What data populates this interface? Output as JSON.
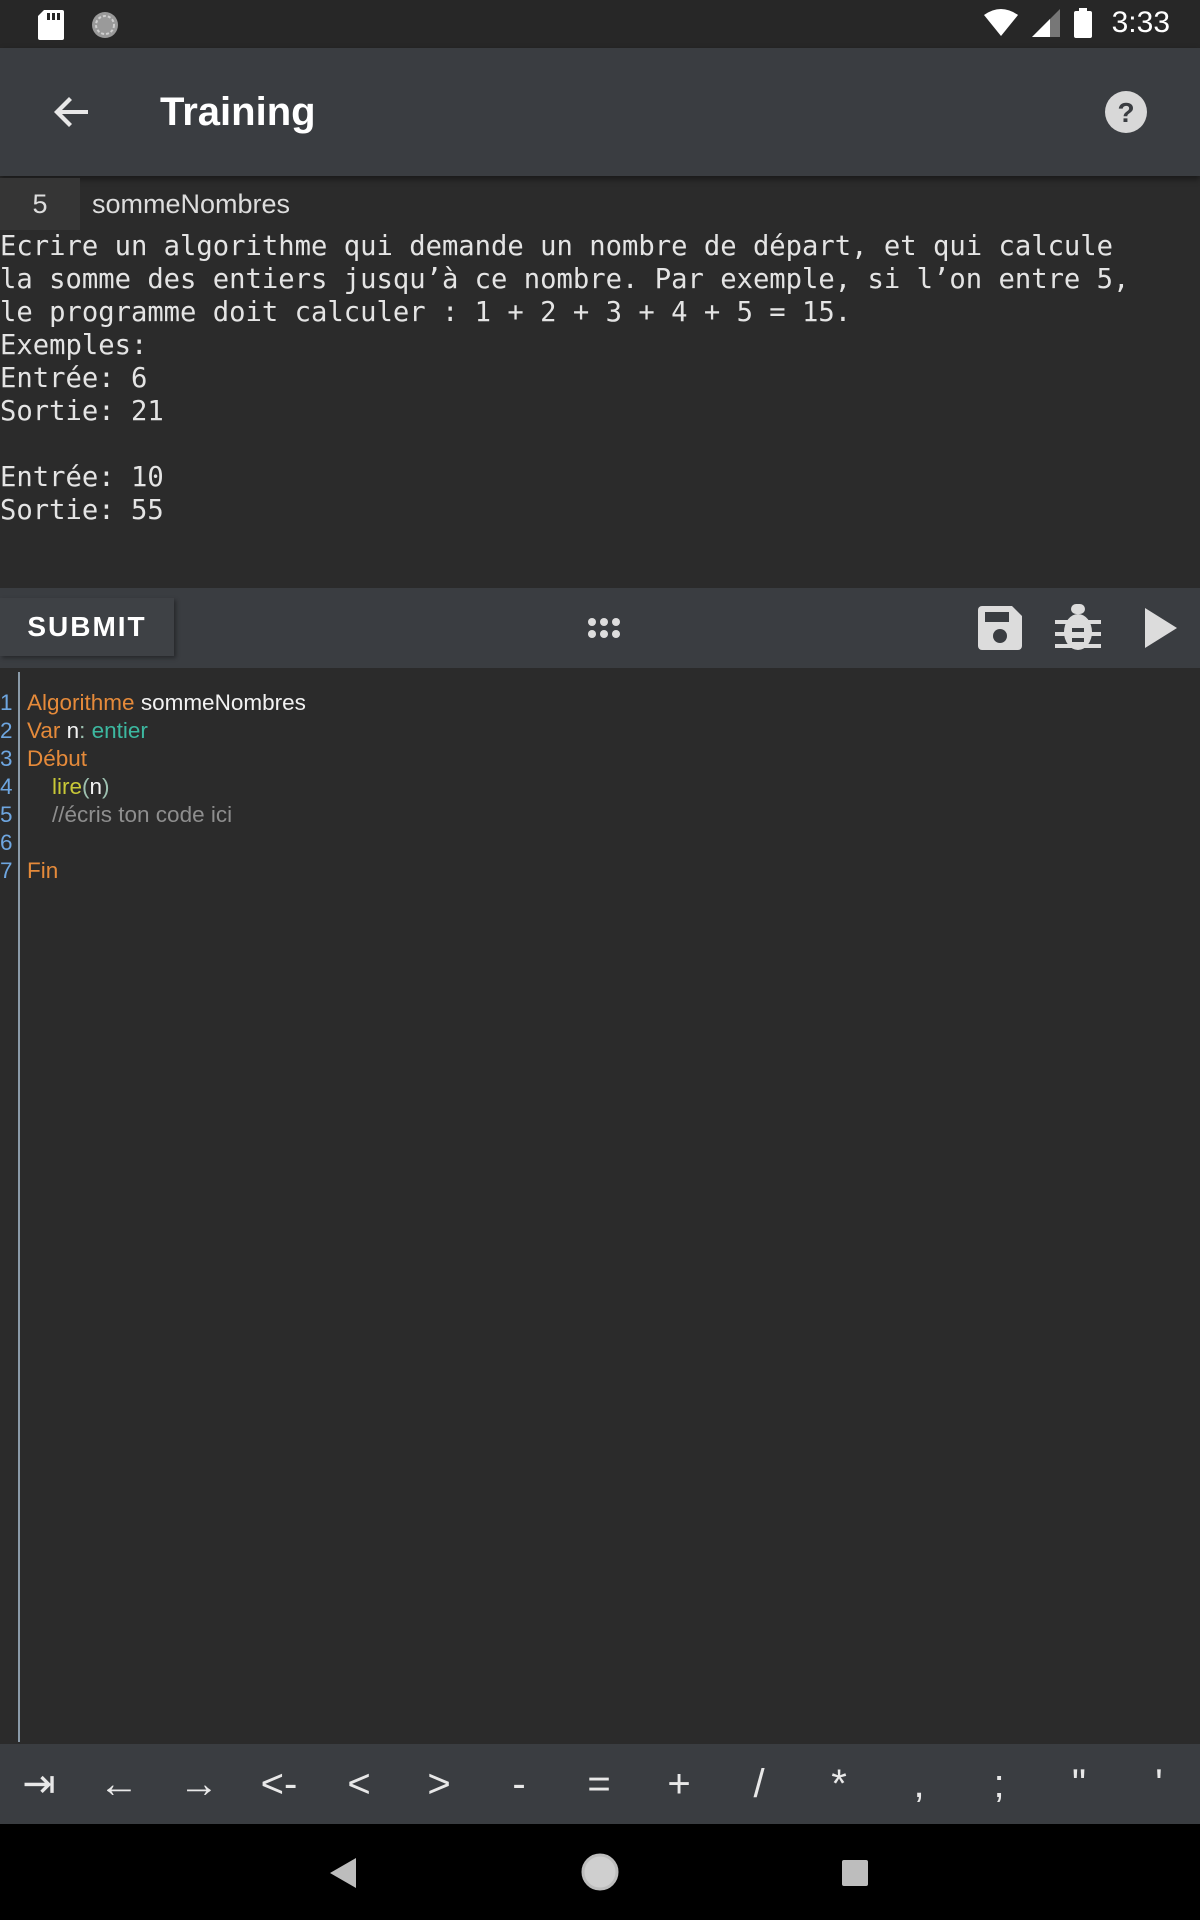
{
  "status_bar": {
    "time": "3:33",
    "left_icons": [
      "sd-card-icon",
      "sync-icon"
    ],
    "right_icons": [
      "wifi-icon",
      "signal-icon",
      "battery-icon"
    ]
  },
  "app_bar": {
    "title": "Training",
    "back_icon": "arrow-back-icon",
    "help_icon": "help-icon"
  },
  "problem": {
    "number": "5",
    "name": "sommeNombres",
    "description": "Ecrire un algorithme qui demande un nombre de départ, et qui calcule\nla somme des entiers jusqu’à ce nombre. Par exemple, si l’on entre 5,\nle programme doit calculer : 1 + 2 + 3 + 4 + 5 = 15.\nExemples:\nEntrée: 6\nSortie: 21\n\nEntrée: 10\nSortie: 55"
  },
  "toolbar": {
    "submit_label": "SUBMIT",
    "icons": [
      "more-dots-icon",
      "save-icon",
      "debug-bug-icon",
      "play-icon"
    ]
  },
  "editor": {
    "lines": [
      {
        "n": "1",
        "tokens": [
          {
            "t": "Algorithme",
            "c": "kw"
          },
          {
            "t": " ",
            "c": "id"
          },
          {
            "t": "sommeNombres",
            "c": "id"
          }
        ]
      },
      {
        "n": "2",
        "tokens": [
          {
            "t": "Var",
            "c": "kw"
          },
          {
            "t": " ",
            "c": "id"
          },
          {
            "t": "n",
            "c": "id"
          },
          {
            "t": ": ",
            "c": "pn"
          },
          {
            "t": "entier",
            "c": "ty"
          }
        ]
      },
      {
        "n": "3",
        "tokens": [
          {
            "t": "Début",
            "c": "kw"
          }
        ]
      },
      {
        "n": "4",
        "tokens": [
          {
            "t": "    ",
            "c": "id"
          },
          {
            "t": "lire",
            "c": "fn"
          },
          {
            "t": "(",
            "c": "pn"
          },
          {
            "t": "n",
            "c": "id"
          },
          {
            "t": ")",
            "c": "pn"
          }
        ]
      },
      {
        "n": "5",
        "tokens": [
          {
            "t": "    ",
            "c": "id"
          },
          {
            "t": "//écris ton code ici",
            "c": "cm"
          }
        ]
      },
      {
        "n": "6",
        "tokens": []
      },
      {
        "n": "7",
        "tokens": [
          {
            "t": "Fin",
            "c": "kw"
          }
        ]
      }
    ]
  },
  "key_bar": {
    "keys": [
      {
        "label": "⇥",
        "name": "tab-key"
      },
      {
        "label": "←",
        "name": "left-arrow-key"
      },
      {
        "label": "→",
        "name": "right-arrow-key"
      },
      {
        "label": "<-",
        "name": "assign-key"
      },
      {
        "label": "<",
        "name": "less-than-key"
      },
      {
        "label": ">",
        "name": "greater-than-key"
      },
      {
        "label": "-",
        "name": "minus-key"
      },
      {
        "label": "=",
        "name": "equals-key"
      },
      {
        "label": "+",
        "name": "plus-key"
      },
      {
        "label": "/",
        "name": "slash-key"
      },
      {
        "label": "*",
        "name": "asterisk-key"
      },
      {
        "label": ",",
        "name": "comma-key"
      },
      {
        "label": ";",
        "name": "semicolon-key"
      },
      {
        "label": "\"",
        "name": "double-quote-key"
      },
      {
        "label": "'",
        "name": "single-quote-key"
      }
    ]
  },
  "nav_bar": {
    "icons": [
      "nav-back-icon",
      "nav-home-icon",
      "nav-recents-icon"
    ]
  }
}
